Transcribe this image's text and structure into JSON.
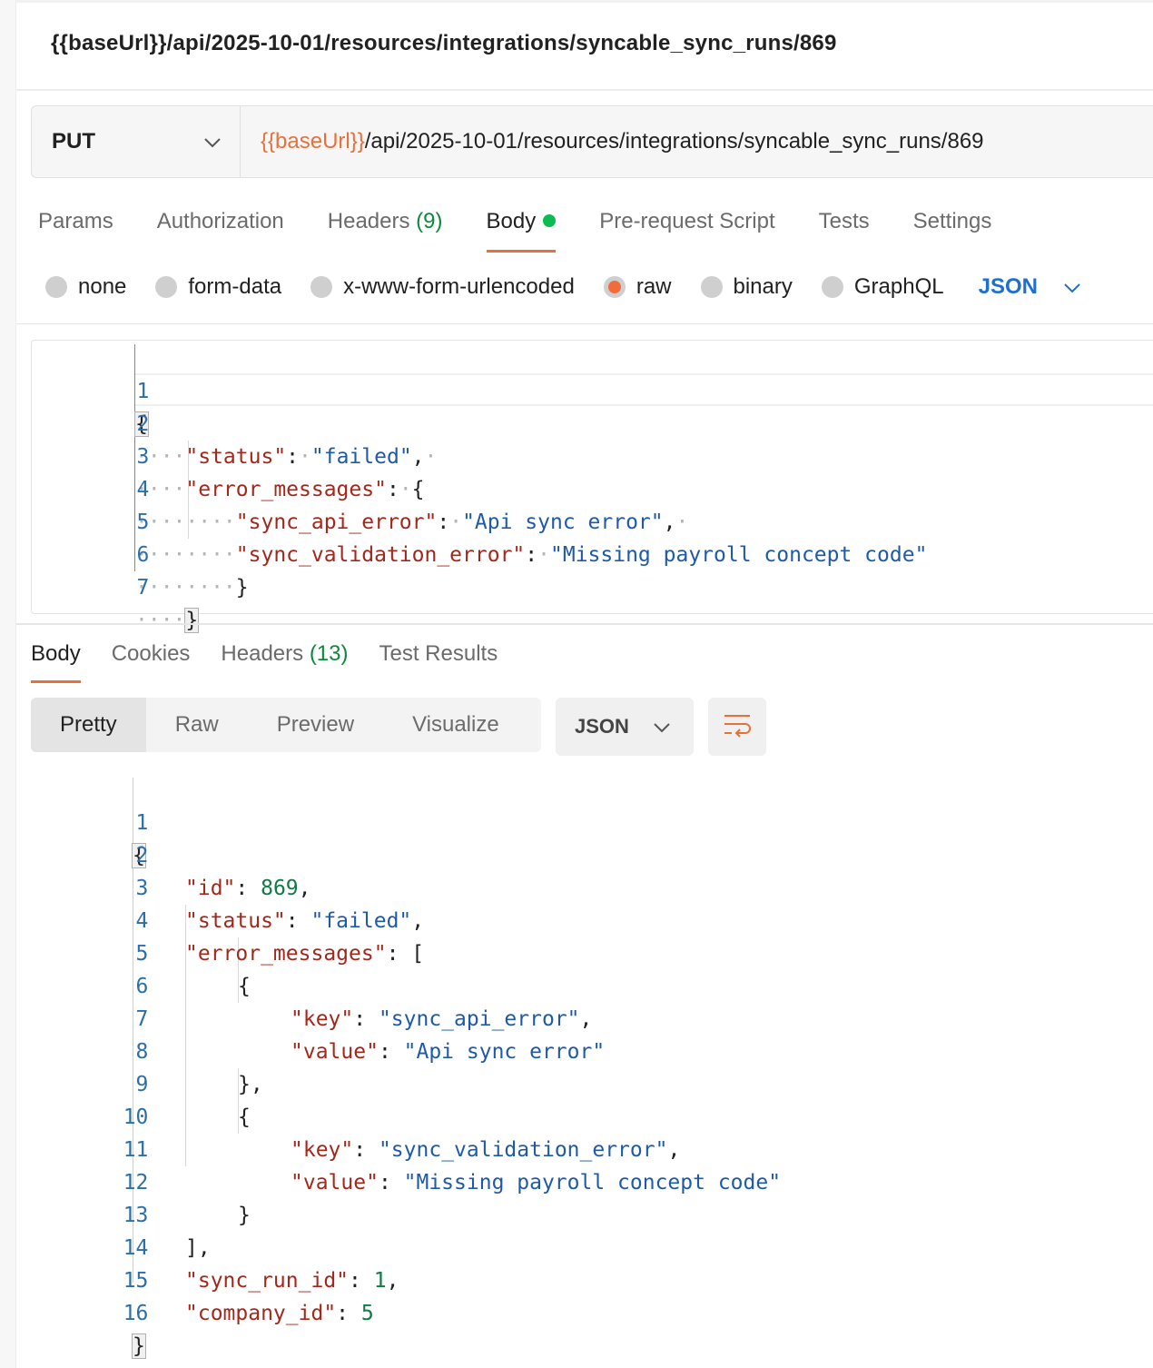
{
  "title": "{{baseUrl}}/api/2025-10-01/resources/integrations/syncable_sync_runs/869",
  "request": {
    "method": "PUT",
    "url_variable": "{{baseUrl}}",
    "url_path": "/api/2025-10-01/resources/integrations/syncable_sync_runs/869"
  },
  "request_tabs": [
    {
      "label": "Params"
    },
    {
      "label": "Authorization"
    },
    {
      "label": "Headers",
      "count": "(9)"
    },
    {
      "label": "Body",
      "active": true
    },
    {
      "label": "Pre-request Script"
    },
    {
      "label": "Tests"
    },
    {
      "label": "Settings"
    }
  ],
  "body_types": [
    "none",
    "form-data",
    "x-www-form-urlencoded",
    "raw",
    "binary",
    "GraphQL"
  ],
  "body_type_selected": "raw",
  "body_language": "JSON",
  "request_body_lines": [
    "1",
    "2",
    "3",
    "4",
    "5",
    "6",
    "7"
  ],
  "request_body": {
    "status_key": "\"status\"",
    "status_val": "\"failed\"",
    "error_messages_key": "\"error_messages\"",
    "sync_api_error_key": "\"sync_api_error\"",
    "sync_api_error_val": "\"Api sync error\"",
    "sync_validation_error_key": "\"sync_validation_error\"",
    "sync_validation_error_val": "\"Missing payroll concept code\""
  },
  "response_tabs": [
    {
      "label": "Body",
      "active": true
    },
    {
      "label": "Cookies"
    },
    {
      "label": "Headers",
      "count": "(13)"
    },
    {
      "label": "Test Results"
    }
  ],
  "view_modes": [
    "Pretty",
    "Raw",
    "Preview",
    "Visualize"
  ],
  "view_mode_selected": "Pretty",
  "response_format": "JSON",
  "response_body_lines": [
    "1",
    "2",
    "3",
    "4",
    "5",
    "6",
    "7",
    "8",
    "9",
    "10",
    "11",
    "12",
    "13",
    "14",
    "15",
    "16"
  ],
  "response_body": {
    "id_key": "\"id\"",
    "id_val": "869",
    "status_key": "\"status\"",
    "status_val": "\"failed\"",
    "error_messages_key": "\"error_messages\"",
    "key_key": "\"key\"",
    "value_key": "\"value\"",
    "item1_key": "\"sync_api_error\"",
    "item1_value": "\"Api sync error\"",
    "item2_key": "\"sync_validation_error\"",
    "item2_value": "\"Missing payroll concept code\"",
    "sync_run_id_key": "\"sync_run_id\"",
    "sync_run_id_val": "1",
    "company_id_key": "\"company_id\"",
    "company_id_val": "5"
  },
  "colors": {
    "accent": "#e8703a",
    "json_key": "#a3281b",
    "json_string": "#1f5aa8",
    "json_number": "#127a45",
    "link_blue": "#1f6fd1",
    "status_green": "#0cbb52"
  }
}
